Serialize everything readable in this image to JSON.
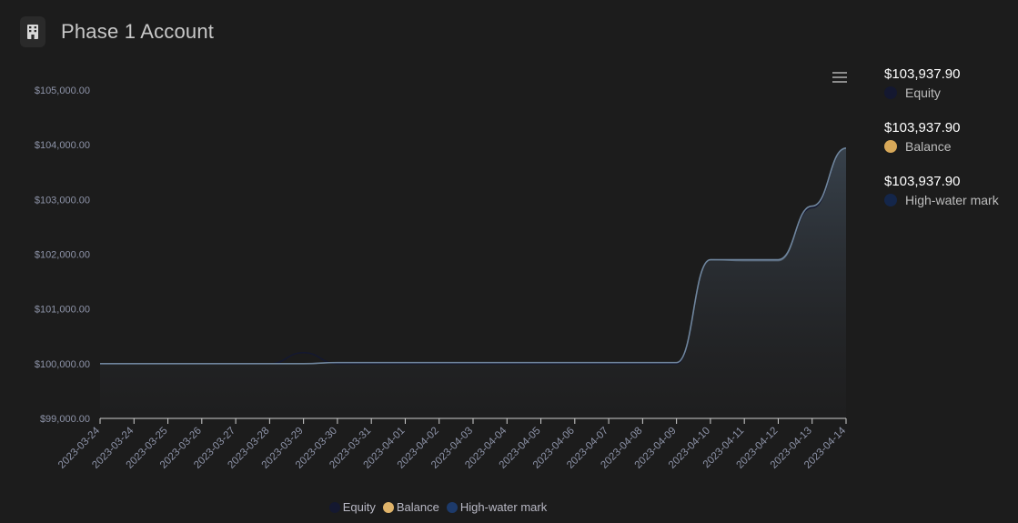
{
  "header": {
    "title": "Phase 1 Account",
    "icon": "building-icon"
  },
  "toolbar": {
    "menu_icon": "hamburger-menu-icon"
  },
  "colors": {
    "equity": "#141830",
    "balance": "#e0b060",
    "hwm": "#1a2e55",
    "line": "#6f859c"
  },
  "summary": [
    {
      "value": "$103,937.90",
      "label": "Equity",
      "color": "#141830"
    },
    {
      "value": "$103,937.90",
      "label": "Balance",
      "color": "#d7a859"
    },
    {
      "value": "$103,937.90",
      "label": "High-water mark",
      "color": "#14264a"
    }
  ],
  "legend": [
    {
      "label": "Equity",
      "color": "#141830"
    },
    {
      "label": "Balance",
      "color": "#e0b46a"
    },
    {
      "label": "High-water mark",
      "color": "#1d3a6a"
    }
  ],
  "chart_data": {
    "type": "area",
    "title": "",
    "xlabel": "",
    "ylabel": "",
    "ylim": [
      99000,
      105000
    ],
    "yticks": [
      99000,
      100000,
      101000,
      102000,
      103000,
      104000,
      105000
    ],
    "ytick_labels": [
      "$99,000.00",
      "$100,000.00",
      "$101,000.00",
      "$102,000.00",
      "$103,000.00",
      "$104,000.00",
      "$105,000.00"
    ],
    "xtick_labels": [
      "2023-03-24",
      "2023-03-24",
      "2023-03-25",
      "2023-03-26",
      "2023-03-27",
      "2023-03-28",
      "2023-03-29",
      "2023-03-30",
      "2023-03-31",
      "2023-04-01",
      "2023-04-02",
      "2023-04-03",
      "2023-04-04",
      "2023-04-05",
      "2023-04-06",
      "2023-04-07",
      "2023-04-08",
      "2023-04-09",
      "2023-04-10",
      "2023-04-11",
      "2023-04-12",
      "2023-04-13",
      "2023-04-14"
    ],
    "x": [
      0,
      1,
      2,
      3,
      4,
      5,
      6,
      7,
      8,
      9,
      10,
      11,
      12,
      13,
      14,
      15,
      16,
      17,
      18,
      19,
      20,
      21,
      22
    ],
    "series": [
      {
        "name": "Equity",
        "values": [
          100000,
          100000,
          100000,
          100000,
          100000,
          100000,
          100200,
          100000,
          100000,
          100000,
          100000,
          100000,
          100000,
          100000,
          100000,
          100000,
          100000,
          100000,
          101900,
          101900,
          101900,
          102850,
          103937.9
        ]
      },
      {
        "name": "Balance",
        "values": [
          100000,
          100000,
          100000,
          100000,
          100000,
          100000,
          100000,
          100020,
          100020,
          100020,
          100020,
          100020,
          100020,
          100020,
          100020,
          100020,
          100020,
          100020,
          101900,
          101880,
          101880,
          102880,
          103937.9
        ]
      },
      {
        "name": "High-water mark",
        "values": [
          100000,
          100000,
          100000,
          100000,
          100000,
          100000,
          100000,
          100020,
          100020,
          100020,
          100020,
          100020,
          100020,
          100020,
          100020,
          100020,
          100020,
          100020,
          101900,
          101900,
          101900,
          102880,
          103937.9
        ]
      }
    ],
    "grid": false,
    "legend_position": "bottom"
  }
}
